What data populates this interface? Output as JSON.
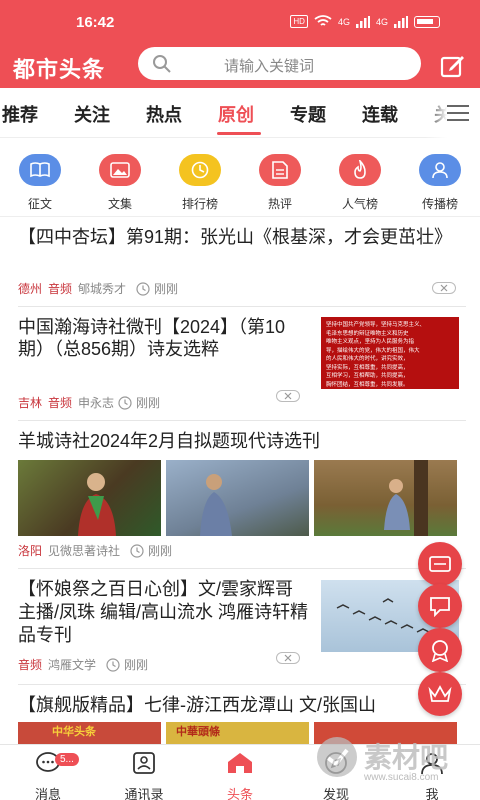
{
  "status": {
    "time": "16:42",
    "hd": "HD",
    "signal1": "4G",
    "signal2": "4G"
  },
  "app": {
    "title": "都市头条",
    "search_placeholder": "请输入关键词"
  },
  "tabs": [
    "推荐",
    "关注",
    "热点",
    "原创",
    "专题",
    "连载",
    "关"
  ],
  "active_tab": "原创",
  "categories": [
    {
      "label": "征文",
      "icon": "book-icon",
      "color": "#5b8ee6"
    },
    {
      "label": "文集",
      "icon": "image-icon",
      "color": "#ee5a5a"
    },
    {
      "label": "排行榜",
      "icon": "clock-icon",
      "color": "#f4c320"
    },
    {
      "label": "热评",
      "icon": "document-icon",
      "color": "#ee5a5a"
    },
    {
      "label": "人气榜",
      "icon": "flame-icon",
      "color": "#ee5a5a"
    },
    {
      "label": "传播榜",
      "icon": "people-icon",
      "color": "#5b8ee6"
    }
  ],
  "articles": [
    {
      "title": "【四中杏坛】第91期：张光山《根基深，才会更茁壮》",
      "location": "德州",
      "tag": "音频",
      "source": "郇城秀才",
      "time": "刚刚"
    },
    {
      "title": "中国瀚海诗社微刊【2024】（第10期）（总856期）诗友选粹",
      "location": "吉林",
      "tag": "音频",
      "source": "申永志",
      "time": "刚刚",
      "thumb_lines": [
        "坚持中国共产党领导，坚持马克思主义、",
        "毛泽东思想的辩证唯物主义和历史",
        "唯物主义观点，坚持为人民服务为指",
        "导，描绘伟大的党，伟大的祖国，伟大",
        "的人民和伟大的时代，讲究实效，",
        "坚持实际，互相尊重，共同提高，",
        "互相学习，互相帮助，共同提高，",
        "胸怀团结，互相尊重，共同发展。"
      ]
    },
    {
      "title": "羊城诗社2024年2月自拟题现代诗选刊",
      "location": "洛阳",
      "source": "见微思著诗社",
      "time": "刚刚"
    },
    {
      "title": "【怀娘祭之百日心创】文/雲家辉哥 主播/凤珠 编辑/高山流水 鸿雁诗轩精品专刊",
      "tag": "音频",
      "source": "鸿雁文学",
      "time": "刚刚"
    },
    {
      "title": "【旗舰版精品】七律-游江西龙潭山 文/张国山",
      "thumb_texts": [
        "中华头条",
        "中華頭條"
      ]
    }
  ],
  "bottom_nav": [
    {
      "label": "消息",
      "badge": "5..."
    },
    {
      "label": "通讯录"
    },
    {
      "label": "头条"
    },
    {
      "label": "发现"
    },
    {
      "label": "我"
    }
  ],
  "watermark": {
    "text": "素材吧",
    "url": "www.sucai8.com"
  },
  "colors": {
    "brand": "#ee4f55",
    "tag_red": "#c8343b"
  }
}
